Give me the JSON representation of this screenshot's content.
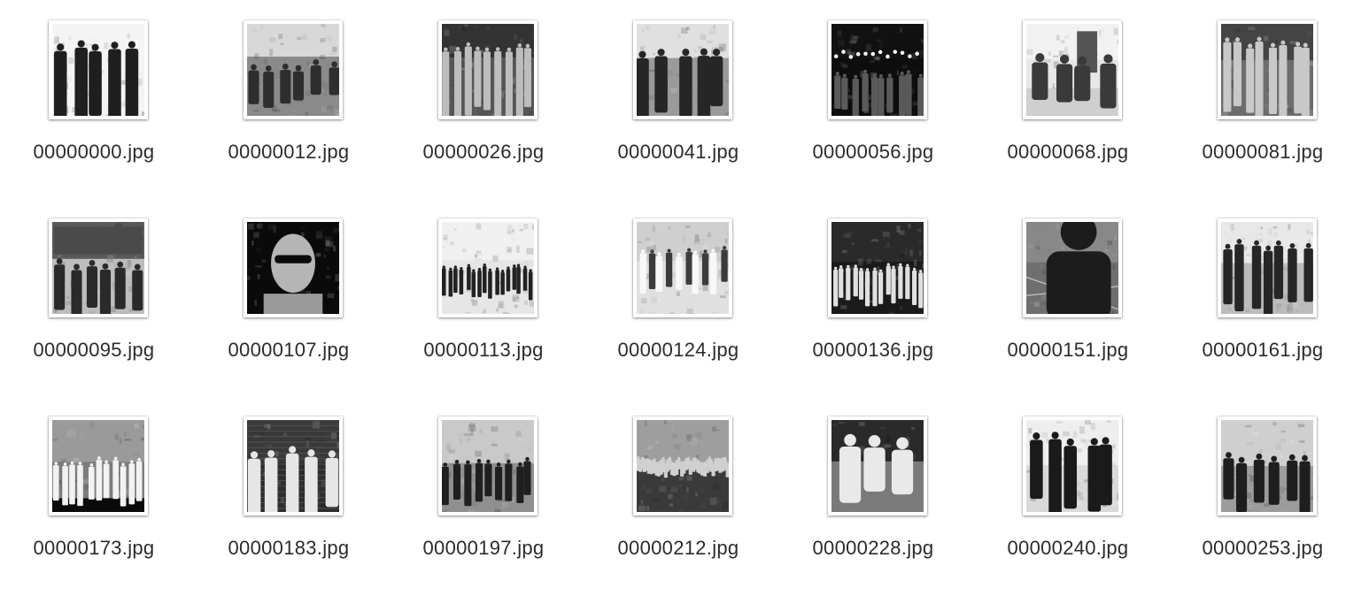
{
  "files": [
    {
      "name": "00000000.jpg",
      "thumb": "people-group-portrait-icon"
    },
    {
      "name": "00000012.jpg",
      "thumb": "cyclists-path-icon"
    },
    {
      "name": "00000026.jpg",
      "thumb": "crowd-group-icon"
    },
    {
      "name": "00000041.jpg",
      "thumb": "band-stage-icon"
    },
    {
      "name": "00000056.jpg",
      "thumb": "night-crowd-lights-icon"
    },
    {
      "name": "00000068.jpg",
      "thumb": "building-entrance-people-icon"
    },
    {
      "name": "00000081.jpg",
      "thumb": "children-group-icon"
    },
    {
      "name": "00000095.jpg",
      "thumb": "classroom-icon"
    },
    {
      "name": "00000107.jpg",
      "thumb": "man-sunglasses-portrait-icon"
    },
    {
      "name": "00000113.jpg",
      "thumb": "outdoor-group-icon"
    },
    {
      "name": "00000124.jpg",
      "thumb": "chefs-group-icon"
    },
    {
      "name": "00000136.jpg",
      "thumb": "night-street-crowd-icon"
    },
    {
      "name": "00000151.jpg",
      "thumb": "runner-track-icon"
    },
    {
      "name": "00000161.jpg",
      "thumb": "indoor-group-icon"
    },
    {
      "name": "00000173.jpg",
      "thumb": "stage-performance-icon"
    },
    {
      "name": "00000183.jpg",
      "thumb": "musicians-brick-wall-icon"
    },
    {
      "name": "00000197.jpg",
      "thumb": "park-people-icon"
    },
    {
      "name": "00000212.jpg",
      "thumb": "large-crowd-bridge-icon"
    },
    {
      "name": "00000228.jpg",
      "thumb": "field-hockey-icon"
    },
    {
      "name": "00000240.jpg",
      "thumb": "people-hats-icon"
    },
    {
      "name": "00000253.jpg",
      "thumb": "room-people-icon"
    }
  ]
}
